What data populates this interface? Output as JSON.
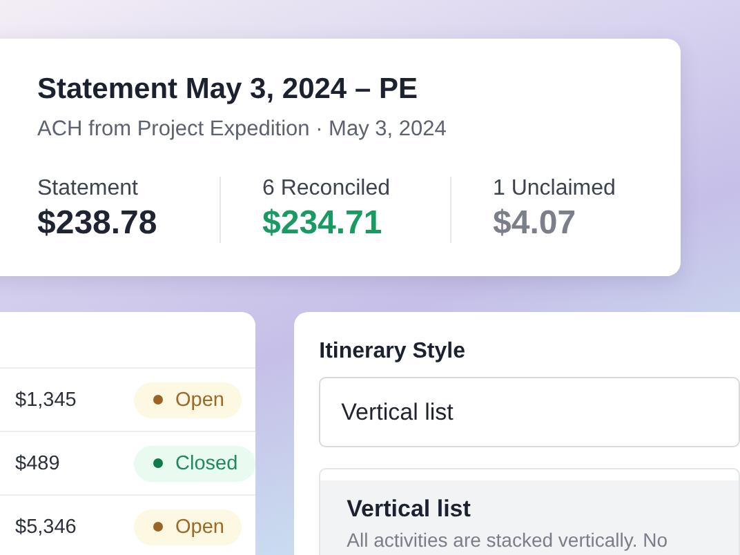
{
  "statement": {
    "title": "Statement May 3, 2024 – PE",
    "subtitle": "ACH from Project Expedition · May 3, 2024",
    "stats": [
      {
        "label": "Statement",
        "value": "$238.78",
        "kind": "total"
      },
      {
        "label": "6 Reconciled",
        "value": "$234.71",
        "kind": "reconciled"
      },
      {
        "label": "1 Unclaimed",
        "value": "$4.07",
        "kind": "unclaimed"
      }
    ]
  },
  "table": {
    "rows": [
      {
        "amount": "$1,345",
        "status": "Open",
        "kind": "open"
      },
      {
        "amount": "$489",
        "status": "Closed",
        "kind": "closed"
      },
      {
        "amount": "$5,346",
        "status": "Open",
        "kind": "open"
      }
    ]
  },
  "itinerary": {
    "label": "Itinerary Style",
    "value": "Vertical list",
    "options": [
      {
        "title": "Vertical list",
        "description": "All activities are stacked vertically. No",
        "selected": true
      }
    ]
  }
}
